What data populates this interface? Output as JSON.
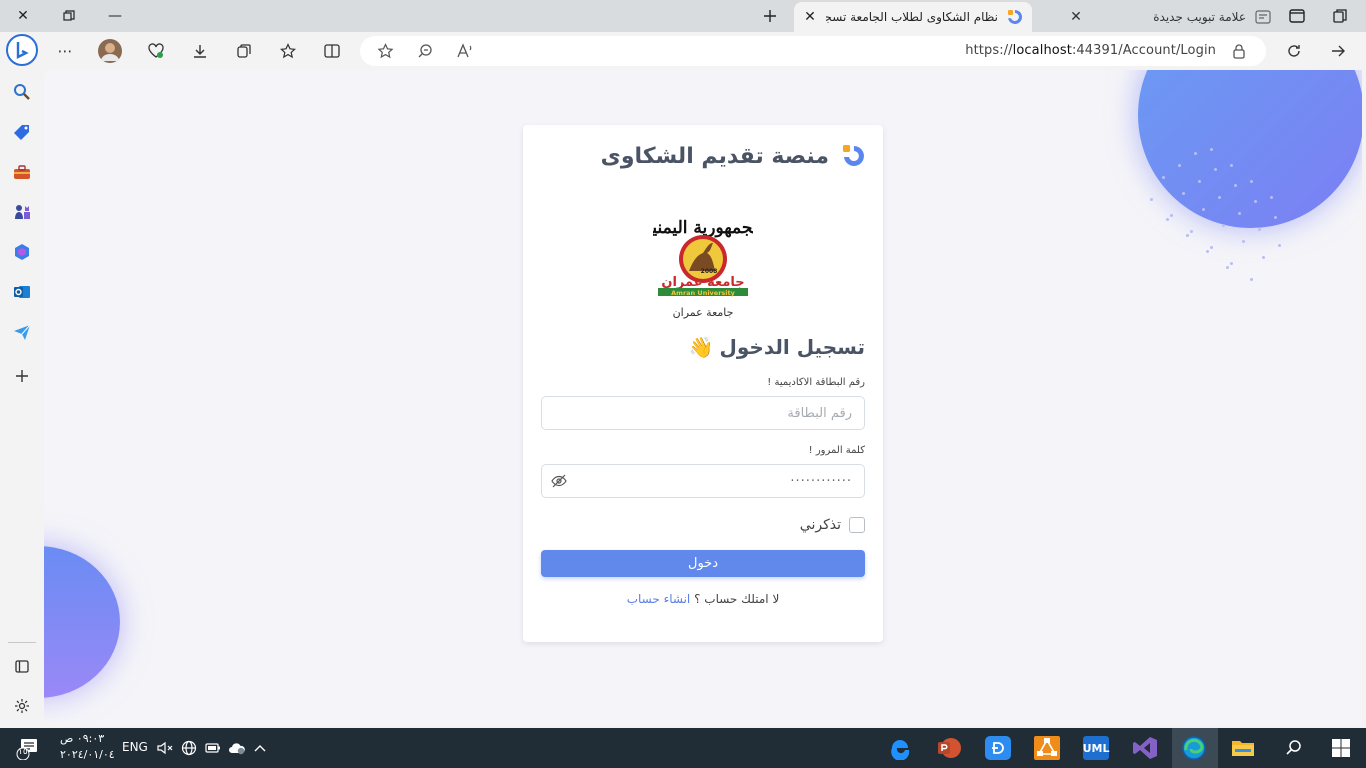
{
  "browser": {
    "active_tab": {
      "title": "نظام الشكاوى لطلاب الجامعة تسجيل"
    },
    "inactive_tab": {
      "title": "علامة تبويب جديدة"
    },
    "url_prefix": "https://",
    "url_host": "localhost",
    "url_rest": ":44391/Account/Login"
  },
  "page": {
    "brand_name": "منصة تقديم الشكاوى",
    "logo_top_text": "الجمهورية اليمنية",
    "logo_uni_ar": "جامعة عمران",
    "logo_uni_en": "Amran University",
    "logo_year": "2008",
    "logo_caption": "جامعة عمران",
    "heading": "تسجيل الدخول",
    "heading_emoji": "👋",
    "card_label": "رقم البطاقة الاكاديمية !",
    "card_placeholder": "رقم البطاقة",
    "password_label": "كلمة المرور !",
    "password_value": "············",
    "remember_label": "تذكرني",
    "login_button": "دخول",
    "no_account_text": "لا امتلك حساب ؟",
    "register_link": "انشاء حساب"
  },
  "taskbar": {
    "notification_count": "١٥",
    "time": "٠٩:٠٣ ص",
    "date": "٢٠٢٤/٠١/٠٤",
    "language": "ENG",
    "uml_label": "UML"
  },
  "colors": {
    "primary": "#6189ec",
    "heading": "#4a5464",
    "taskbar": "#202d36"
  }
}
